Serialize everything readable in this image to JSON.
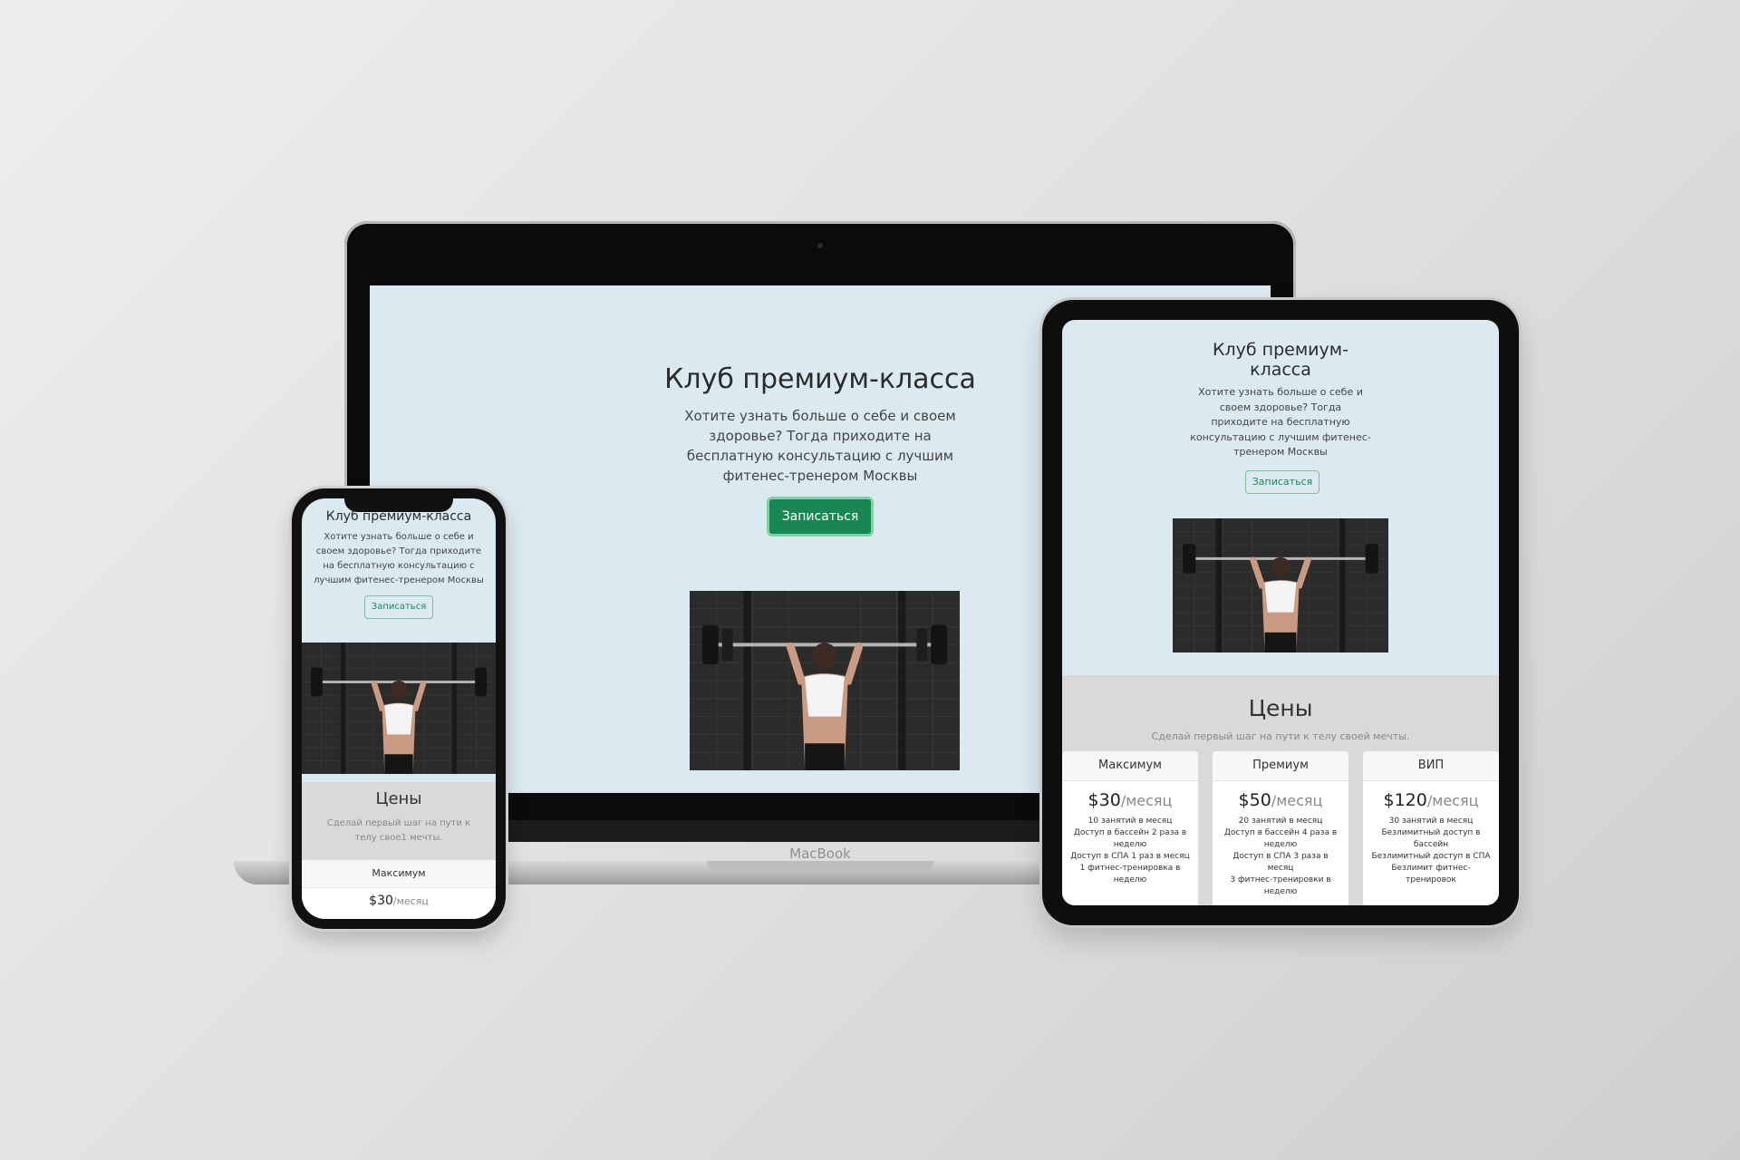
{
  "hero": {
    "title": "Клуб премиум-класса",
    "subtitle": "Хотите узнать больше о себе и своем здоровье? Тогда приходите на бесплатную консультацию с лучшим фитенес-тренером Москвы",
    "cta_label": "Записаться"
  },
  "prices": {
    "title": "Цены",
    "subtitle": "Сделай первый шаг на пути к телу своей мечты.",
    "subtitle_phone": "Сделай первый шаг на пути к телу свое1 мечты.",
    "unit": "/месяц",
    "plans": [
      {
        "name": "Максимум",
        "price": "$30",
        "features": [
          "10 занятий в месяц",
          "Доступ в бассейн 2 раза в неделю",
          "Доступ в СПА 1 раз в месяц",
          "1 фитнес-тренировка в неделю"
        ]
      },
      {
        "name": "Премиум",
        "price": "$50",
        "features": [
          "20 занятий в месяц",
          "Доступ в бассейн 4 раза в неделю",
          "Доступ в СПА 3 раза в месяц",
          "3 фитнес-тренировки в неделю"
        ]
      },
      {
        "name": "ВИП",
        "price": "$120",
        "features": [
          "30 занятий в месяц",
          "Безлимитный доступ в бассейн",
          "Безлимитный доступ в СПА",
          "Безлимит фитнес-тренировок"
        ]
      }
    ]
  },
  "device": {
    "laptop_label": "MacBook"
  },
  "colors": {
    "accent": "#198754",
    "page_bg": "#dbeaf0",
    "section_bg": "#d9d9d9"
  }
}
